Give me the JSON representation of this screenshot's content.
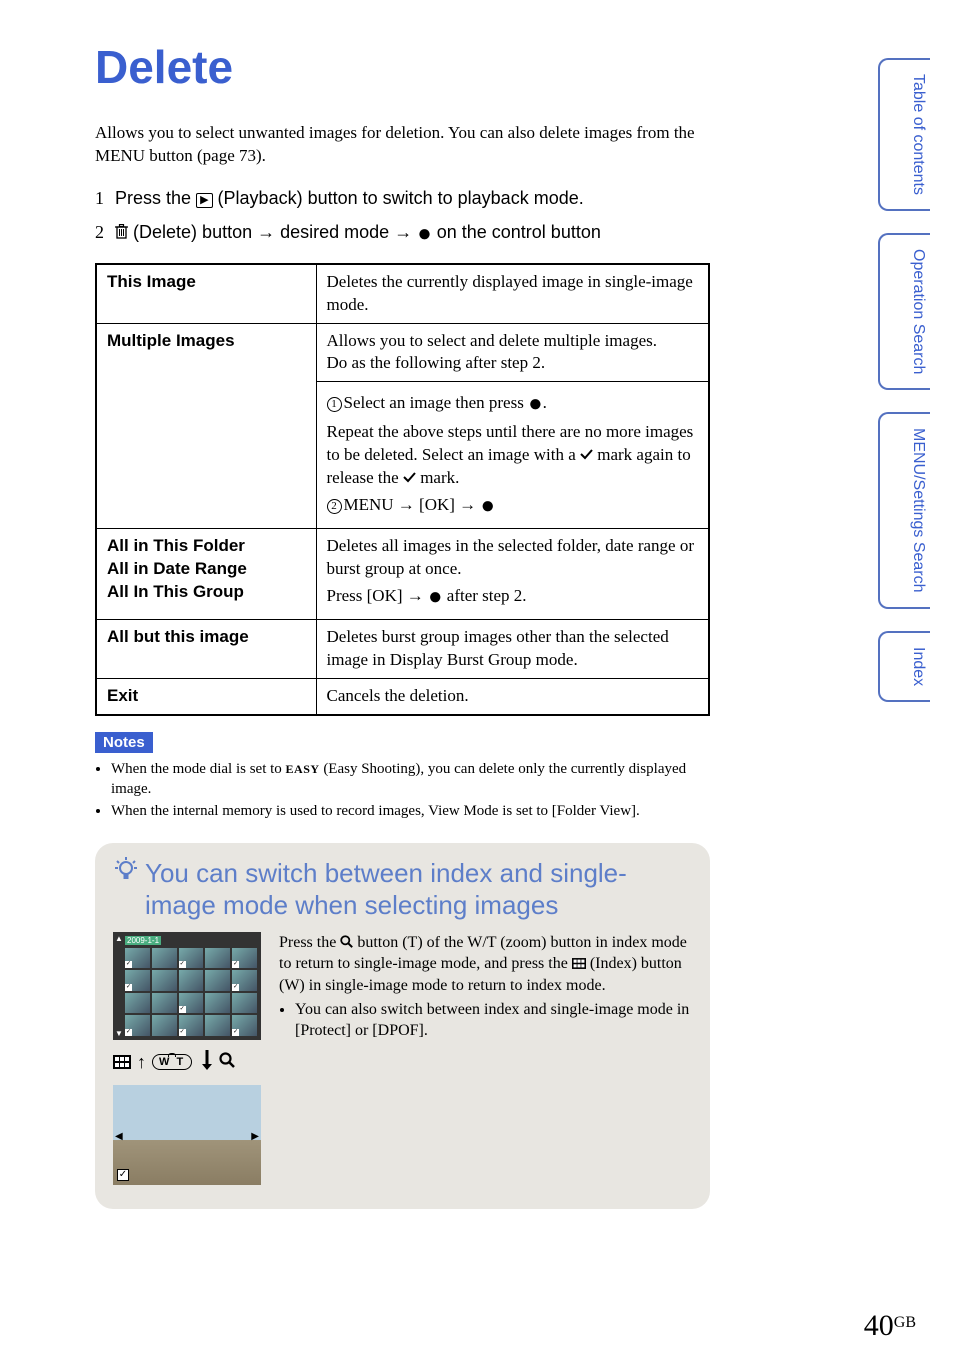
{
  "title": "Delete",
  "intro": "Allows you to select unwanted images for deletion. You can also delete images from the MENU button (page 73).",
  "steps": {
    "s1_prefix": "Press the ",
    "s1_suffix": " (Playback) button to switch to playback mode.",
    "s2_prefix": " (Delete) button ",
    "s2_mid": " desired mode ",
    "s2_suffix": " on the control button"
  },
  "table": {
    "rows": [
      {
        "label": "This Image",
        "desc": "Deletes the currently displayed image in single-image mode."
      },
      {
        "label": "Multiple Images",
        "desc_top": "Allows you to select and delete multiple images.\nDo as the following after step 2.",
        "sub1_a": "Select an image then press ",
        "sub1_b": ".\nRepeat the above steps until there are no more images to be deleted. Select an image with a ",
        "sub1_c": " mark again to release the ",
        "sub1_d": " mark.",
        "sub2": "MENU → [OK] → "
      },
      {
        "label": "All in This Folder\nAll in Date Range\nAll In This Group",
        "desc": "Deletes all images in the selected folder, date range or burst group at once.\nPress [OK] → ",
        "desc_suffix": " after step 2."
      },
      {
        "label": "All but this image",
        "desc": "Deletes burst group images other than the selected image in Display Burst Group mode."
      },
      {
        "label": "Exit",
        "desc": "Cancels the deletion."
      }
    ]
  },
  "notes": {
    "badge": "Notes",
    "items": [
      "When the mode dial is set to EASY (Easy Shooting), you can delete only the currently displayed image.",
      "When the internal memory is used to record images, View Mode is set to [Folder View]."
    ]
  },
  "tip": {
    "title": "You can switch between index and single-image mode when selecting images",
    "body_a": "Press the ",
    "body_b": " button (T) of the W/T (zoom) button in index mode to return to single-image mode, and press the ",
    "body_c": " (Index) button (W) in single-image mode to return to index mode.",
    "sub": "You can also switch between index and single-image mode in [Protect] or [DPOF].",
    "date_tab": "2009-1-1",
    "wt_label": "W  T"
  },
  "side_tabs": [
    "Table of contents",
    "Operation Search",
    "MENU/Settings Search",
    "Index"
  ],
  "page": {
    "num": "40",
    "suffix": "GB"
  }
}
